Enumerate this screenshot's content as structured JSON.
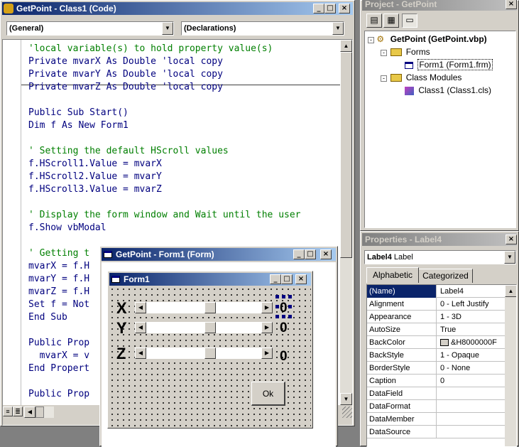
{
  "code_window": {
    "title": "GetPoint - Class1 (Code)",
    "object_combo": "(General)",
    "proc_combo": "(Declarations)",
    "lines": [
      {
        "text": "'local variable(s) to hold property value(s)",
        "kind": "comment"
      },
      {
        "text": "Private mvarX As Double 'local copy",
        "kind": "code"
      },
      {
        "text": "Private mvarY As Double 'local copy",
        "kind": "code"
      },
      {
        "text": "Private mvarZ As Double 'local copy",
        "kind": "code"
      },
      {
        "text": "",
        "kind": "code"
      },
      {
        "text": "Public Sub Start()",
        "kind": "code"
      },
      {
        "text": "Dim f As New Form1",
        "kind": "code"
      },
      {
        "text": "",
        "kind": "code"
      },
      {
        "text": "' Setting the default HScroll values",
        "kind": "comment"
      },
      {
        "text": "f.HScroll1.Value = mvarX",
        "kind": "code"
      },
      {
        "text": "f.HScroll2.Value = mvarY",
        "kind": "code"
      },
      {
        "text": "f.HScroll3.Value = mvarZ",
        "kind": "code"
      },
      {
        "text": "",
        "kind": "code"
      },
      {
        "text": "' Display the form window and Wait until the user",
        "kind": "comment"
      },
      {
        "text": "f.Show vbModal",
        "kind": "code"
      },
      {
        "text": "",
        "kind": "code"
      },
      {
        "text": "' Getting t",
        "kind": "comment"
      },
      {
        "text": "mvarX = f.H",
        "kind": "code"
      },
      {
        "text": "mvarY = f.H",
        "kind": "code"
      },
      {
        "text": "mvarZ = f.H",
        "kind": "code"
      },
      {
        "text": "Set f = Not",
        "kind": "code"
      },
      {
        "text": "End Sub",
        "kind": "code"
      },
      {
        "text": "",
        "kind": "code"
      },
      {
        "text": "Public Prop",
        "kind": "code"
      },
      {
        "text": "  mvarX = v",
        "kind": "code"
      },
      {
        "text": "End Propert",
        "kind": "code"
      },
      {
        "text": "",
        "kind": "code"
      },
      {
        "text": "Public Prop",
        "kind": "code"
      }
    ]
  },
  "project_window": {
    "title": "Project - GetPoint",
    "root": "GetPoint (GetPoint.vbp)",
    "forms_folder": "Forms",
    "form_item": "Form1 (Form1.frm)",
    "class_folder": "Class Modules",
    "class_item": "Class1 (Class1.cls)"
  },
  "properties_window": {
    "title": "Properties - Label4",
    "object_name": "Label4",
    "object_type": "Label",
    "tab_alpha": "Alphabetic",
    "tab_cat": "Categorized",
    "rows": [
      {
        "name": "(Name)",
        "value": "Label4"
      },
      {
        "name": "Alignment",
        "value": "0 - Left Justify"
      },
      {
        "name": "Appearance",
        "value": "1 - 3D"
      },
      {
        "name": "AutoSize",
        "value": "True"
      },
      {
        "name": "BackColor",
        "value": "&H8000000F"
      },
      {
        "name": "BackStyle",
        "value": "1 - Opaque"
      },
      {
        "name": "BorderStyle",
        "value": "0 - None"
      },
      {
        "name": "Caption",
        "value": "0"
      },
      {
        "name": "DataField",
        "value": ""
      },
      {
        "name": "DataFormat",
        "value": ""
      },
      {
        "name": "DataMember",
        "value": ""
      },
      {
        "name": "DataSource",
        "value": ""
      }
    ]
  },
  "form_designer": {
    "title": "GetPoint - Form1 (Form)",
    "form_title": "Form1",
    "x_label": "X",
    "y_label": "Y",
    "z_label": "Z",
    "x_value": "0",
    "y_value": "0",
    "z_value": "0",
    "ok_label": "Ok"
  },
  "colors": {
    "active_title": "#0a246a",
    "code_keyword": "#00007f",
    "code_comment": "#007f00"
  }
}
